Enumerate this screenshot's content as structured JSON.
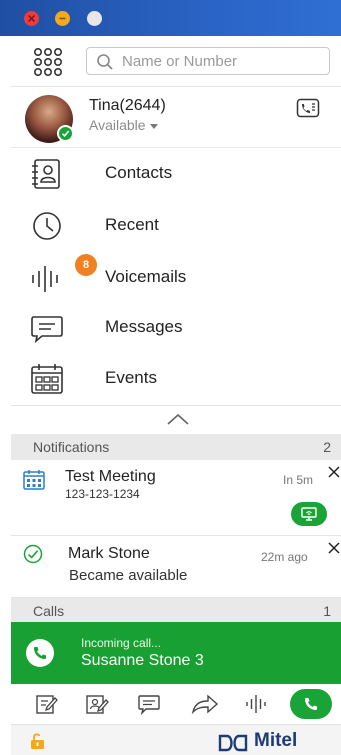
{
  "window": {
    "controls": [
      "close",
      "minimize",
      "maximize"
    ]
  },
  "search": {
    "placeholder": "Name or Number",
    "value": ""
  },
  "profile": {
    "name": "Tina(2644)",
    "status": "Available",
    "status_color": "#19a33a"
  },
  "nav": [
    {
      "id": "contacts",
      "label": "Contacts",
      "icon": "contacts-book-icon"
    },
    {
      "id": "recent",
      "label": "Recent",
      "icon": "clock-icon"
    },
    {
      "id": "voicemails",
      "label": "Voicemails",
      "icon": "voicemail-waveform-icon",
      "badge": "8"
    },
    {
      "id": "messages",
      "label": "Messages",
      "icon": "chat-bubble-icon"
    },
    {
      "id": "events",
      "label": "Events",
      "icon": "calendar-icon"
    }
  ],
  "notifications": {
    "title": "Notifications",
    "count": "2",
    "items": [
      {
        "title": "Test Meeting",
        "subtitle": "123-123-1234",
        "time": "In 5m",
        "icon": "calendar-icon"
      },
      {
        "title": "Mark Stone",
        "subtitle": "Became available",
        "time": "22m ago",
        "icon": "check-circle-icon"
      }
    ]
  },
  "calls": {
    "title": "Calls",
    "count": "1",
    "incoming": {
      "label": "Incoming call...",
      "name": "Susanne Stone 3"
    }
  },
  "toolbar": {
    "buttons": [
      "edit-note-icon",
      "contact-note-icon",
      "chat-bubble-icon",
      "forward-arrow-icon",
      "waveform-icon",
      "answer-call-icon"
    ]
  },
  "footer": {
    "brand": "Mitel"
  },
  "colors": {
    "accent_green": "#1aa336",
    "titlebar": "#2a63c4",
    "badge": "#f08020",
    "brand": "#1d3c75"
  }
}
